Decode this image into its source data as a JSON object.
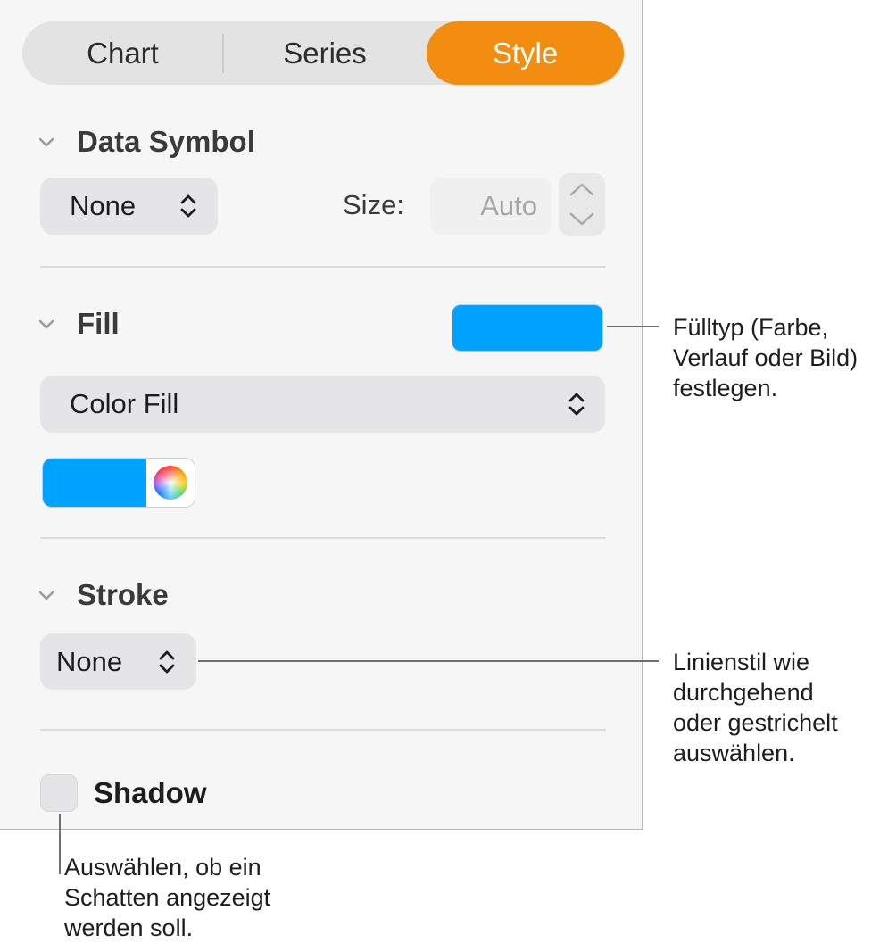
{
  "tabs": {
    "chart": "Chart",
    "series": "Series",
    "style": "Style",
    "active": "style"
  },
  "data_symbol": {
    "title": "Data Symbol",
    "symbol_value": "None",
    "size_label": "Size:",
    "size_placeholder": "Auto"
  },
  "fill": {
    "title": "Fill",
    "swatch_color": "#00a2ff",
    "fill_type": "Color Fill",
    "color_well_color": "#00a2ff"
  },
  "stroke": {
    "title": "Stroke",
    "value": "None"
  },
  "shadow": {
    "label": "Shadow",
    "checked": false
  },
  "callouts": {
    "fill": "Fülltyp (Farbe,\nVerlauf oder Bild)\nfestlegen.",
    "stroke": "Linienstil wie\ndurchgehend\noder gestrichelt\nauswählen.",
    "shadow": "Auswählen, ob ein\nSchatten angezeigt\nwerden soll."
  },
  "colors": {
    "accent": "#f28d0f",
    "fill_blue": "#00a2ff"
  }
}
